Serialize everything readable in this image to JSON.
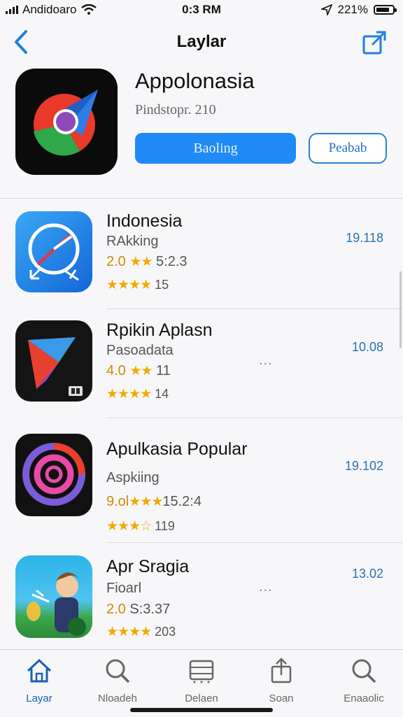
{
  "status_bar": {
    "carrier": "Andidoaro",
    "time": "0:3 RM",
    "battery": "221%",
    "battery_level": 0.8
  },
  "nav": {
    "title": "Laylar",
    "back_icon": "chevron-left-icon",
    "share_icon": "share-icon"
  },
  "featured": {
    "name": "Appolonasia",
    "subtitle": "Pindstopr. 210",
    "primary_button": "Baoling",
    "secondary_button": "Peabab"
  },
  "apps": [
    {
      "title": "Indonesia",
      "category": "RAkking",
      "rating_num": "2.0",
      "rating_stars": "★★",
      "rating_rest": "5:2.3",
      "stars": "★★★★",
      "count": "15",
      "price": "19.118",
      "more": ""
    },
    {
      "title": "Rpikin Aplasn",
      "category": "Pasoadata",
      "rating_num": "4.0",
      "rating_stars": "★★",
      "rating_rest": "11",
      "stars": "★★★★",
      "count": "14",
      "price": "10.08",
      "more": "..."
    },
    {
      "title": "Apulkasia Popular",
      "category": "Aspkiing",
      "rating_num": "9.ol",
      "rating_stars": "★★★",
      "rating_rest": "15.2:4",
      "stars": "★★★☆",
      "count": "119",
      "price": "19.102",
      "more": ""
    },
    {
      "title": "Apr Sragia",
      "category": "Fioarl",
      "rating_num": "2.0",
      "rating_stars": "",
      "rating_rest": "S:3.37",
      "stars": "★★★★",
      "count": "203",
      "price": "13.02",
      "more": "..."
    }
  ],
  "tabs": [
    {
      "label": "Layar",
      "icon": "home-icon",
      "active": true
    },
    {
      "label": "Nloadeh",
      "icon": "search-icon",
      "active": false
    },
    {
      "label": "Delaen",
      "icon": "list-icon",
      "active": false
    },
    {
      "label": "Soan",
      "icon": "share-icon",
      "active": false
    },
    {
      "label": "Enaaolic",
      "icon": "search-icon",
      "active": false
    }
  ],
  "colors": {
    "accent": "#1f8af5",
    "star": "#f2a900",
    "price": "#2a6fb0"
  }
}
